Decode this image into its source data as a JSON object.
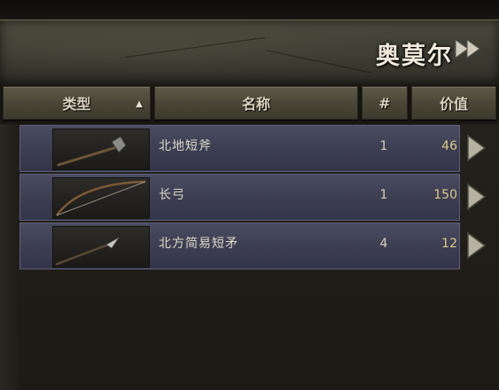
{
  "merchant": {
    "name": "奥莫尔"
  },
  "columns": {
    "type": "类型",
    "name": "名称",
    "count": "#",
    "value": "价值"
  },
  "items": [
    {
      "name": "北地短斧",
      "count": "1",
      "value": "46",
      "icon": "axe-icon"
    },
    {
      "name": "长弓",
      "count": "1",
      "value": "150",
      "icon": "longbow-icon"
    },
    {
      "name": "北方简易短矛",
      "count": "4",
      "value": "12",
      "icon": "spear-icon"
    }
  ],
  "colors": {
    "row": "#3d3e52",
    "value_text": "#d9c889",
    "header_text": "#f1eadc"
  }
}
